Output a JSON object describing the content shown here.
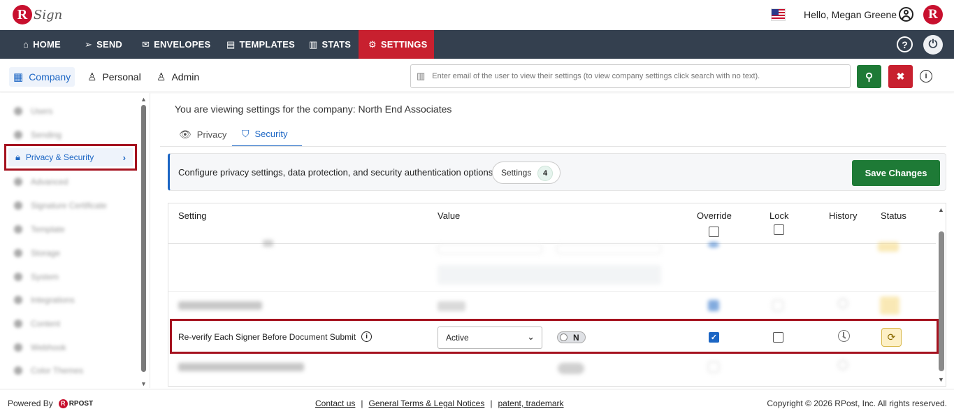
{
  "header": {
    "logo_letter": "R",
    "logo_text": "Sign",
    "greeting": "Hello, Megan Greene",
    "avatar_letter": "R"
  },
  "nav": {
    "items": [
      {
        "label": "HOME",
        "icon": "home-icon"
      },
      {
        "label": "SEND",
        "icon": "send-icon"
      },
      {
        "label": "ENVELOPES",
        "icon": "envelope-icon"
      },
      {
        "label": "TEMPLATES",
        "icon": "document-icon"
      },
      {
        "label": "STATS",
        "icon": "chart-icon"
      },
      {
        "label": "SETTINGS",
        "icon": "gear-icon",
        "active": true
      }
    ],
    "help_label": "?"
  },
  "subnav": {
    "tabs": [
      {
        "label": "Company",
        "icon": "building-icon",
        "active": true
      },
      {
        "label": "Personal",
        "icon": "user-icon"
      },
      {
        "label": "Admin",
        "icon": "user-gear-icon"
      }
    ],
    "search_placeholder": "Enter email of the user to view their settings (to view company settings click search with no text)."
  },
  "sidebar": {
    "active_item": "Privacy & Security"
  },
  "main": {
    "title": "You are viewing settings for the company: North End Associates",
    "tabs": [
      {
        "label": "Privacy",
        "icon": "eye-icon"
      },
      {
        "label": "Security",
        "icon": "shield-icon",
        "active": true
      }
    ],
    "banner_text": "Configure privacy settings, data protection, and security authentication options.",
    "settings_label": "Settings",
    "settings_count": "4",
    "save_label": "Save Changes"
  },
  "table": {
    "columns": [
      "Setting",
      "Value",
      "Override",
      "Lock",
      "History",
      "Status"
    ],
    "highlighted_row": {
      "setting": "Re-verify Each Signer Before Document Submit",
      "value": "Active",
      "toggle": "N",
      "override_checked": true,
      "lock_checked": false
    }
  },
  "footer": {
    "powered_by": "Powered By",
    "rpost": "RPOST",
    "links": [
      "Contact us",
      "General Terms & Legal Notices",
      "patent, trademark"
    ],
    "copyright": "Copyright © 2026 RPost, Inc. All rights reserved."
  },
  "colors": {
    "nav_bg": "#34404f",
    "accent_red": "#c8202f",
    "accent_blue": "#1c66c4",
    "primary_green": "#1e7a36",
    "highlight_border": "#a5121f"
  }
}
